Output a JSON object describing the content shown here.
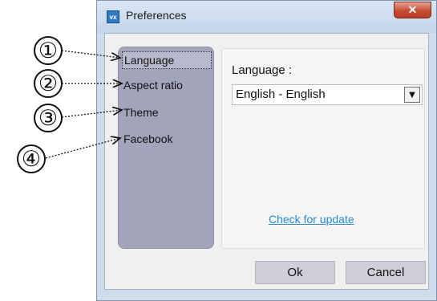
{
  "window": {
    "title": "Preferences",
    "app_icon_label": "vx",
    "close_glyph": "✕"
  },
  "sidebar": {
    "items": [
      {
        "label": "Language",
        "selected": true
      },
      {
        "label": "Aspect ratio",
        "selected": false
      },
      {
        "label": "Theme",
        "selected": false
      },
      {
        "label": "Facebook",
        "selected": false
      }
    ]
  },
  "content": {
    "language_label": "Language :",
    "language_value": "English - English",
    "update_link": "Check for update"
  },
  "buttons": {
    "ok": "Ok",
    "cancel": "Cancel"
  },
  "annotations": {
    "markers": [
      "①",
      "②",
      "③",
      "④"
    ]
  },
  "colors": {
    "sidebar": "#a3a4ba",
    "link": "#2a8bd2",
    "close_button": "#c74c33",
    "frame": "#cfdcec"
  }
}
